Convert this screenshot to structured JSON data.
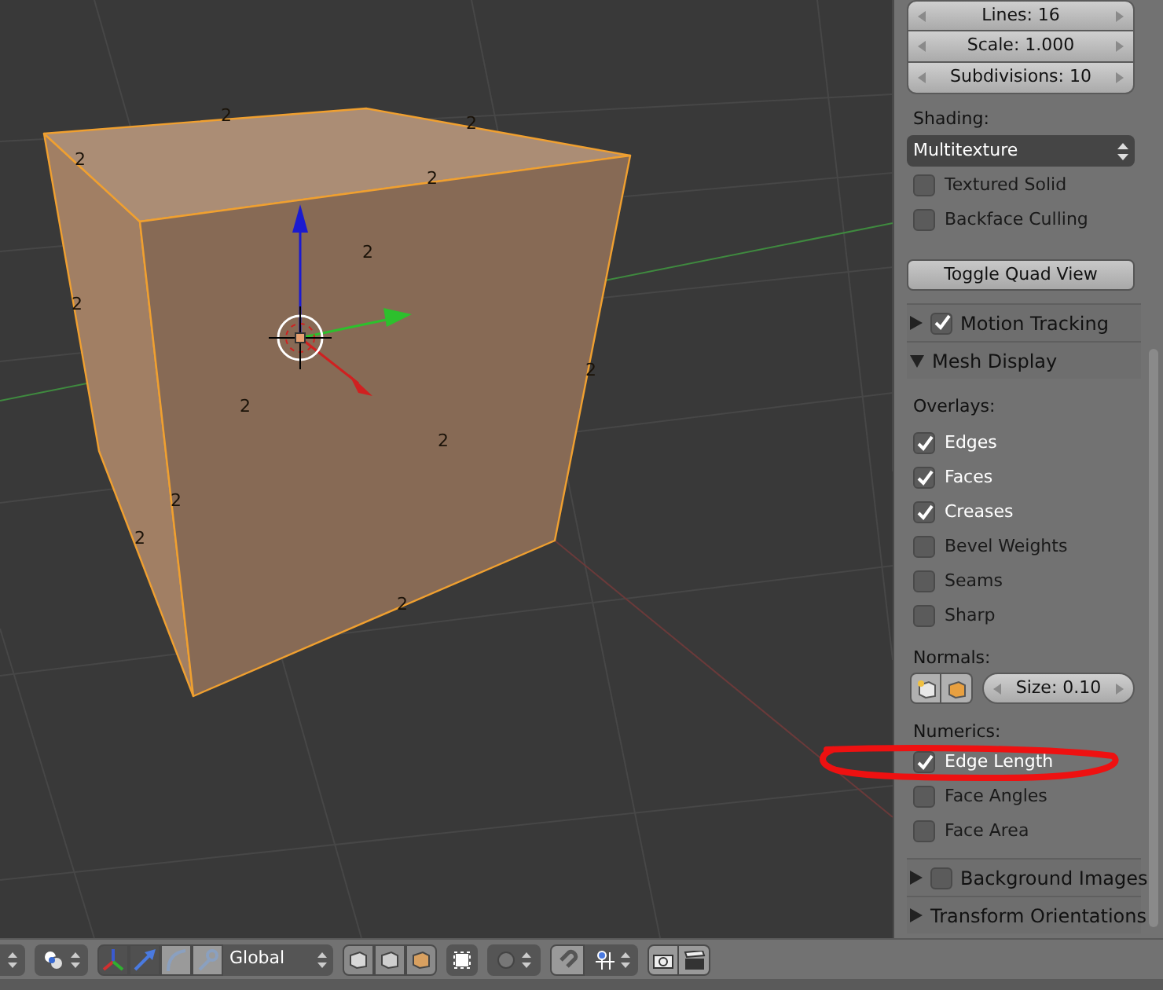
{
  "viewport": {
    "edge_lengths": [
      "2",
      "2",
      "2",
      "2",
      "2",
      "2",
      "2",
      "2",
      "2",
      "2",
      "2",
      "2"
    ]
  },
  "properties_panel": {
    "grid_fields": [
      "Lines: 16",
      "Scale: 1.000",
      "Subdivisions: 10"
    ],
    "shading": {
      "label": "Shading:",
      "value": "Multitexture"
    },
    "shading_options": [
      {
        "label": "Textured Solid",
        "checked": false
      },
      {
        "label": "Backface Culling",
        "checked": false
      }
    ],
    "toggle_button": "Toggle Quad View",
    "sections": [
      {
        "kind": "checkbox",
        "title": "Motion Tracking",
        "expanded": false,
        "checked": true
      },
      {
        "kind": "plain",
        "title": "Mesh Display",
        "expanded": true,
        "overlays_label": "Overlays:",
        "overlays": [
          {
            "label": "Edges",
            "checked": true
          },
          {
            "label": "Faces",
            "checked": true
          },
          {
            "label": "Creases",
            "checked": true
          },
          {
            "label": "Bevel Weights",
            "checked": false
          },
          {
            "label": "Seams",
            "checked": false
          },
          {
            "label": "Sharp",
            "checked": false
          }
        ],
        "normals_label": "Normals:",
        "normals_size": "Size: 0.10",
        "numerics_label": "Numerics:",
        "numerics": [
          {
            "label": "Edge Length",
            "checked": true
          },
          {
            "label": "Face Angles",
            "checked": false
          },
          {
            "label": "Face Area",
            "checked": false
          }
        ]
      },
      {
        "kind": "checkbox",
        "title": "Background Images",
        "expanded": false,
        "checked": false
      },
      {
        "kind": "plain",
        "title": "Transform Orientations",
        "expanded": false
      }
    ]
  },
  "toolbar": {
    "manipulators": [
      {
        "selected": true
      },
      {
        "selected": true
      },
      {
        "selected": false
      },
      {
        "selected": false
      }
    ],
    "orientation": "Global"
  }
}
